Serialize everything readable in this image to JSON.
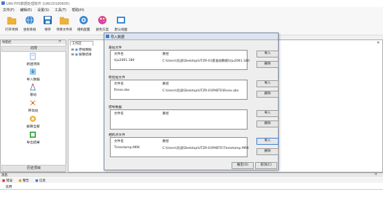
{
  "window": {
    "title": "UAV-FPS数据处理软件 (UAV20180605)"
  },
  "menu": [
    "文件(F)",
    "编辑(E)",
    "设置(S)",
    "工具(T)",
    "帮助(H)"
  ],
  "toolbar": [
    {
      "label": "打开项目",
      "icon": "folder-icon",
      "color": "#f2b233"
    },
    {
      "label": "坐标系统",
      "icon": "globe-icon",
      "color": "#3a8ad6"
    },
    {
      "label": "保存",
      "icon": "save-icon",
      "color": "#2d6fb8"
    },
    {
      "label": "项目文件夹",
      "icon": "folder-icon",
      "color": "#f2b233"
    },
    {
      "label": "相机配置",
      "icon": "camera-icon",
      "color": "#3a8ad6"
    },
    {
      "label": "颜色方案",
      "icon": "palette-icon",
      "color": "#e040a0"
    },
    {
      "label": "默认视图",
      "icon": "view-icon",
      "color": "#3a8ad6"
    }
  ],
  "nav": {
    "panel_title": "导航栏",
    "header": "向导",
    "items": [
      "新建项目",
      "导入数据",
      "基站",
      "移动站",
      "解算全部",
      "导出结果"
    ],
    "footer": "历史项目"
  },
  "work": {
    "tab": "工作区",
    "tree": [
      "原始数据",
      "解算结果"
    ]
  },
  "dialog": {
    "title": "导入数据",
    "groups": [
      {
        "title": "基站文件",
        "col1": "文件名",
        "col2": "路径",
        "val1": "Uju2061.180",
        "val2": "C:\\Users\\比迪\\Desktop\\UTZR-01基准站数据\\Uju2061.180",
        "btn1": "导入",
        "btn2": "删除"
      },
      {
        "title": "移动站文件",
        "col1": "文件名",
        "col2": "路径",
        "val1": "Rinex.obs",
        "val2": "C:\\Users\\比迪\\Desktop\\UTZR-01PABTE\\Rinex.obs",
        "btn1": "导入",
        "btn2": "删除"
      },
      {
        "title": "惯导数据",
        "col1": "文件名",
        "col2": "路径",
        "val1": "",
        "val2": "",
        "btn1": "导入",
        "btn2": "删除"
      },
      {
        "title": "相机点文件",
        "col1": "文件名",
        "col2": "路径",
        "val1": "Timestamp.MRK",
        "val2": "C:\\Users\\比迪\\Desktop\\UTZR-01PABTE\\Timestamp.MRK",
        "btn1": "导入",
        "btn2": "删除"
      }
    ],
    "ok": "确定(O)",
    "cancel": "取消(C)"
  },
  "log": {
    "panel_title": "消息",
    "tabs": [
      "错误",
      "警告",
      "信息"
    ],
    "column": "说明"
  }
}
